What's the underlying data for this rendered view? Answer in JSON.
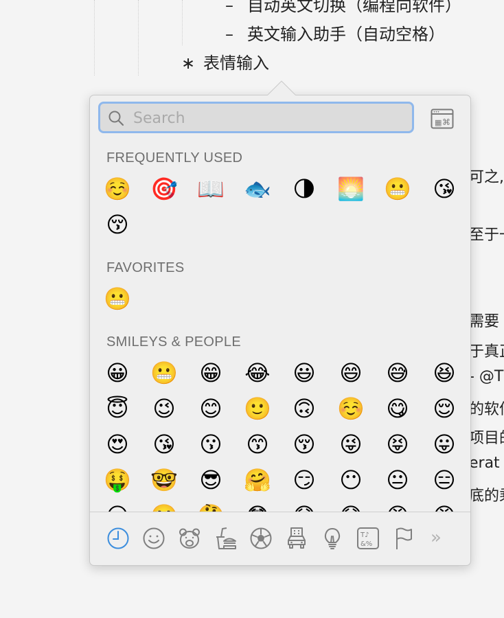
{
  "document": {
    "list": [
      {
        "marker": "–",
        "text": "自动英文切换（编程向软件）"
      },
      {
        "marker": "–",
        "text": "英文输入助手（自动空格）"
      },
      {
        "marker": "∗",
        "text": "表情输入"
      }
    ],
    "right_fragments": [
      "可之,",
      "至于一",
      "需要",
      "于真正",
      "- @T",
      "的软件",
      "项目的",
      "erat",
      "底的乘"
    ]
  },
  "search": {
    "placeholder": "Search",
    "value": ""
  },
  "sections": [
    {
      "title": "FREQUENTLY USED",
      "emojis": [
        "☺️",
        "🎯",
        "📖",
        "🐟",
        "🌗",
        "🌅",
        "😬",
        "😘",
        "😚"
      ]
    },
    {
      "title": "FAVORITES",
      "emojis": [
        "😬"
      ]
    },
    {
      "title": "SMILEYS & PEOPLE",
      "emojis": [
        "😀",
        "😬",
        "😁",
        "😂",
        "😃",
        "😄",
        "😅",
        "😆",
        "😇",
        "😉",
        "😊",
        "🙂",
        "🙃",
        "☺️",
        "😋",
        "😌",
        "😍",
        "😘",
        "😗",
        "😙",
        "😚",
        "😜",
        "😝",
        "😛",
        "🤑",
        "🤓",
        "😎",
        "🤗",
        "😏",
        "😶",
        "😐",
        "😑",
        "😒",
        "🙄",
        "🤔",
        "😳",
        "😞",
        "😟",
        "😠",
        "😡"
      ]
    }
  ],
  "tabs": [
    {
      "id": "recent",
      "icon": "clock-icon",
      "active": true
    },
    {
      "id": "smileys",
      "icon": "smiley-icon",
      "active": false
    },
    {
      "id": "animals",
      "icon": "bear-icon",
      "active": false
    },
    {
      "id": "food",
      "icon": "food-drink-icon",
      "active": false
    },
    {
      "id": "activity",
      "icon": "soccer-ball-icon",
      "active": false
    },
    {
      "id": "travel",
      "icon": "car-building-icon",
      "active": false
    },
    {
      "id": "objects",
      "icon": "lightbulb-icon",
      "active": false
    },
    {
      "id": "symbols",
      "icon": "symbols-icon",
      "active": false
    },
    {
      "id": "flags",
      "icon": "flag-icon",
      "active": false
    }
  ],
  "more_tabs_label": "»",
  "colors": {
    "accent": "#3b8ddd",
    "tab_inactive": "#7f7f7f",
    "search_border": "#8fb8ec"
  }
}
